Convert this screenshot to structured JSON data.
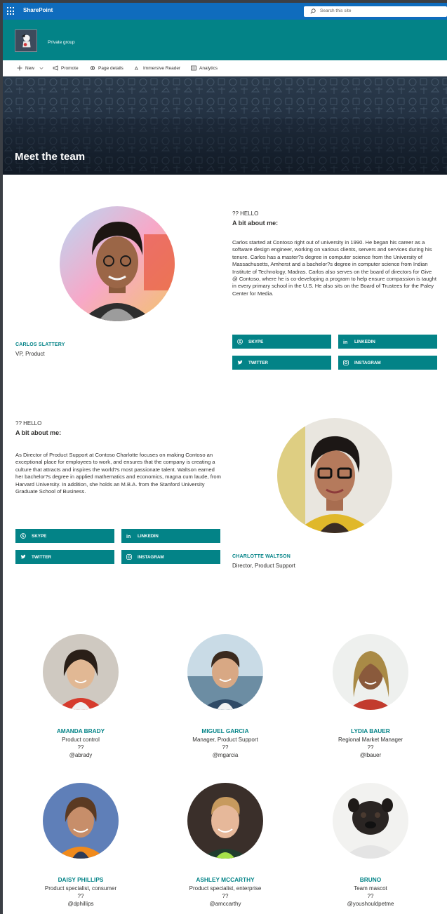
{
  "suitebar": {
    "app_name": "SharePoint",
    "search_placeholder": "Search this site"
  },
  "site": {
    "subtitle": "Private group"
  },
  "commands": {
    "new": "New",
    "promote": "Promote",
    "page_details": "Page details",
    "immersive_reader": "Immersive Reader",
    "analytics": "Analytics"
  },
  "hero": {
    "title": "Meet the team"
  },
  "featured": [
    {
      "name": "CARLOS SLATTERY",
      "role": "VP, Product",
      "hello": "?? HELLO",
      "about_heading": "A bit about me:",
      "bio": "Carlos started at Contoso right out of university in 1990. He began his career as a software design engineer, working on various clients, servers and services during his tenure. Carlos has a master?s degree in computer science from the University of Massachusetts, Amherst and a bachelor?s degree in computer science from Indian Institute of Technology, Madras. Carlos also serves on the board of directors for Give @ Contoso, where he is co-developing a program to help ensure compassion is taught in every primary school in the U.S. He also sits on the Board of Trustees for the Paley Center for Media.",
      "buttons": {
        "skype": "SKYPE",
        "linkedin": "LINKEDIN",
        "twitter": "TWITTER",
        "instagram": "INSTAGRAM"
      }
    },
    {
      "name": "CHARLOTTE WALTSON",
      "role": "Director, Product Support",
      "hello": "?? HELLO",
      "about_heading": "A bit about me:",
      "bio": "As Director of Product Support at Contoso Charlotte focuses on making Contoso an exceptional place for employees to work, and ensures that the company is creating a culture that attracts and inspires the world?s most passionate talent. Waltson earned her bachelor?s degree in applied mathematics and economics, magna cum laude, from Harvard University. In addition, she holds an M.B.A. from the Stanford University Graduate School of Business.",
      "buttons": {
        "skype": "SKYPE",
        "linkedin": "LINKEDIN",
        "twitter": "TWITTER",
        "instagram": "INSTAGRAM"
      }
    }
  ],
  "team": [
    {
      "name": "AMANDA BRADY",
      "title": "Product control",
      "q": "??",
      "handle": "@abrady"
    },
    {
      "name": "MIGUEL GARCIA",
      "title": "Manager, Product Support",
      "q": "??",
      "handle": "@mgarcia"
    },
    {
      "name": "LYDIA BAUER",
      "title": "Regional Market Manager",
      "q": "??",
      "handle": "@lbauer"
    },
    {
      "name": "DAISY PHILLIPS",
      "title": "Product specialist, consumer",
      "q": "??",
      "handle": "@dphillips"
    },
    {
      "name": "ASHLEY MCCARTHY",
      "title": "Product specialist, enterprise",
      "q": "??",
      "handle": "@amccarthy"
    },
    {
      "name": "BRUNO",
      "title": "Team mascot",
      "q": "??",
      "handle": "@youshouldpetme"
    }
  ]
}
